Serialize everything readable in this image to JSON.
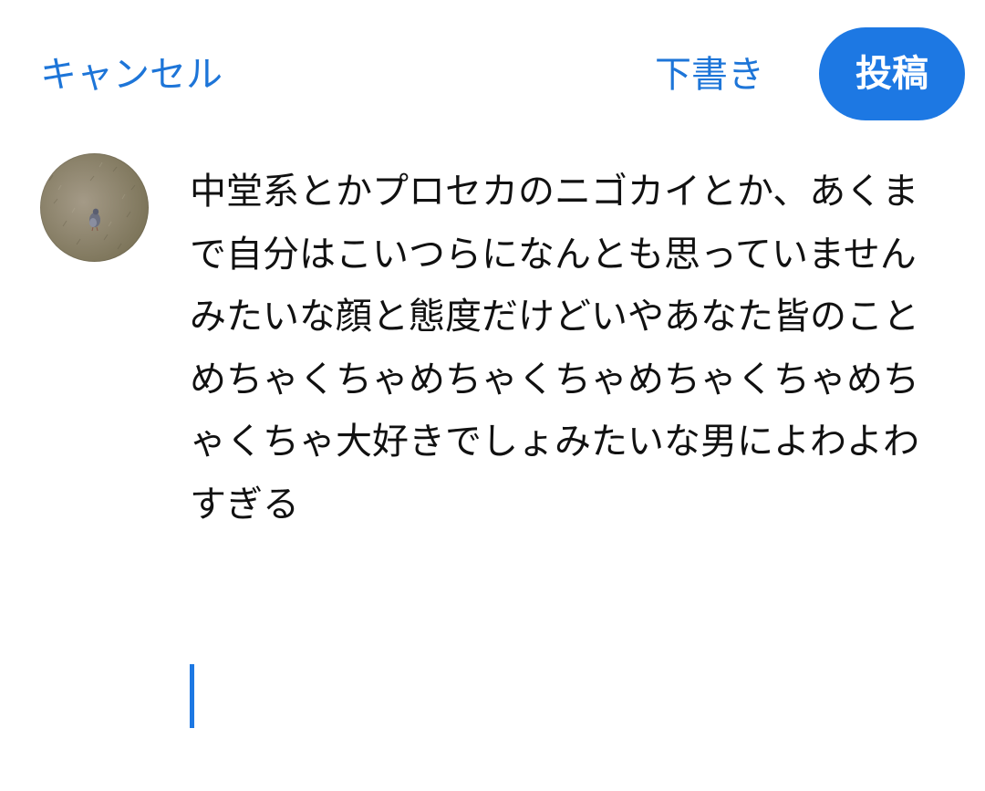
{
  "header": {
    "cancel_label": "キャンセル",
    "draft_label": "下書き",
    "post_label": "投稿"
  },
  "compose": {
    "text": "中堂系とかプロセカのニゴカイとか、あくまで自分はこいつらになんとも思っていませんみたいな顔と態度だけどいやあなた皆のことめちゃくちゃめちゃくちゃめちゃくちゃめちゃくちゃ大好きでしょみたいな男によわよわすぎる"
  },
  "avatar": {
    "icon": "pigeon-on-grass-photo"
  },
  "colors": {
    "accent": "#1d78e3",
    "link": "#1d75d8",
    "text": "#111111",
    "background": "#ffffff"
  }
}
